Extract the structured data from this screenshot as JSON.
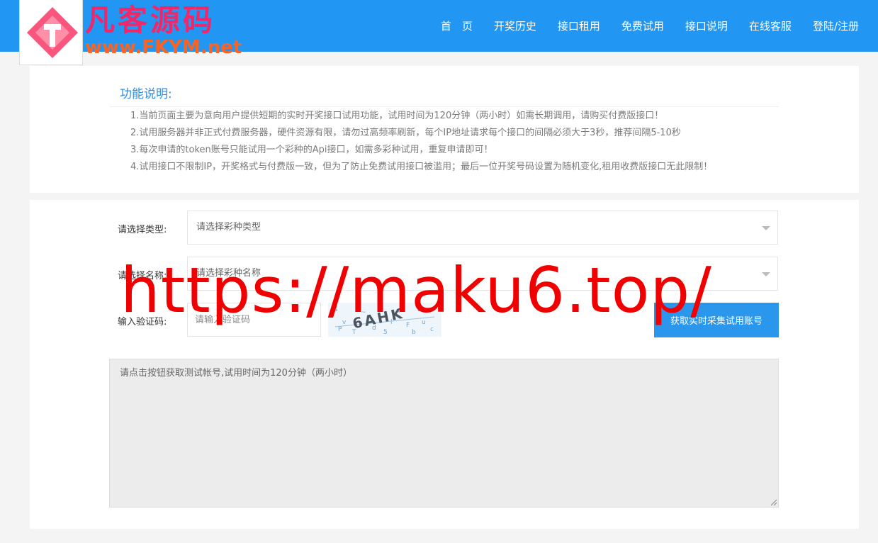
{
  "header": {
    "logo_title": "凡客源码",
    "logo_url": "www.FKYM.net",
    "nav": [
      "首　页",
      "开奖历史",
      "接口租用",
      "免费试用",
      "接口说明",
      "在线客服",
      "登陆/注册"
    ]
  },
  "info": {
    "title": "功能说明:",
    "lines": [
      "1.当前页面主要为意向用户提供短期的实时开奖接口试用功能，试用时间为120分钟（两小时）如需长期调用，请购买付费版接口！",
      "2.试用服务器并非正式付费服务器，硬件资源有限，请勿过高频率刷新，每个IP地址请求每个接口的间隔必须大于3秒，推荐间隔5-10秒",
      "3.每次申请的token账号只能试用一个彩种的Api接口，如需多彩种试用，重复申请即可！",
      "4.试用接口不限制IP，开奖格式与付费版一致，但为了防止免费试用接口被滥用；最后一位开奖号码设置为随机变化,租用收费版接口无此限制！"
    ]
  },
  "form": {
    "type_label": "请选择类型:",
    "type_placeholder": "请选择彩种类型",
    "name_label": "请选择名称:",
    "name_placeholder": "请选择彩种名称",
    "captcha_label": "输入验证码:",
    "captcha_placeholder": "请输入验证码",
    "captcha_text": "6AHK",
    "submit_label": "获取实时采集试用账号",
    "result_text": "请点击按钮获取测试帐号,试用时间为120分钟（两小时）"
  },
  "watermark": "https://maku6.top/",
  "colors": {
    "topbar": "#2196f3",
    "accent": "#2b97ec",
    "logo_title": "#f0286a",
    "logo_url": "#fa6322",
    "watermark": "#f00000"
  }
}
